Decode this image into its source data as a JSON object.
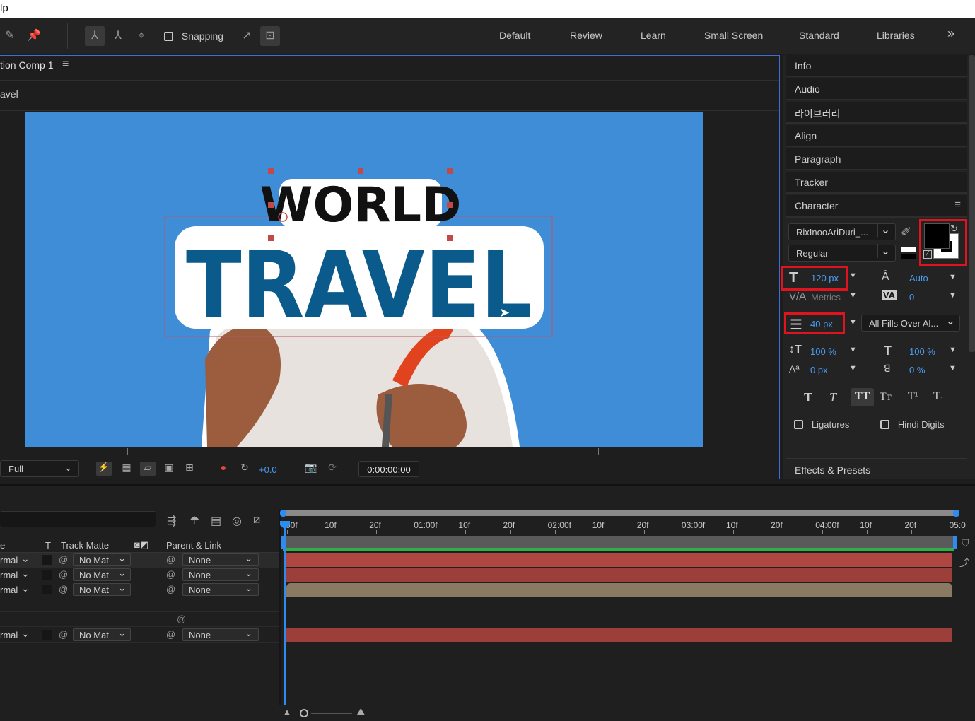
{
  "app": {
    "title_fragment": "lp"
  },
  "toolbar": {
    "snapping_label": "Snapping",
    "workspaces": [
      "Default",
      "Review",
      "Learn",
      "Small Screen",
      "Standard",
      "Libraries"
    ],
    "more_glyph": "»"
  },
  "comp": {
    "tab_title": "tion Comp 1",
    "breadcrumb": "avel",
    "canvas_text_line1": "WORLD",
    "canvas_text_line2": "TRAVEL",
    "resolution": "Full",
    "exposure": "+0.0",
    "timecode": "0:00:00:00",
    "canvas_bg_color": "#3f8dd6",
    "travel_text_color": "#0a5b8c"
  },
  "right_panel": {
    "items": [
      "Info",
      "Audio",
      "라이브러리",
      "Align",
      "Paragraph",
      "Tracker"
    ],
    "character_title": "Character",
    "font_family": "RixInooAriDuri_...",
    "font_style": "Regular",
    "font_size": "120 px",
    "leading": "Auto",
    "kerning": "Metrics",
    "tracking": "0",
    "stroke_width": "40 px",
    "stroke_mode": "All Fills Over Al...",
    "vertical_scale": "100 %",
    "horizontal_scale": "100 %",
    "baseline_shift": "0 px",
    "tsume": "0 %",
    "ligatures_label": "Ligatures",
    "hindi_digits_label": "Hindi Digits",
    "effects_presets": "Effects & Presets",
    "fill_color": "#000000",
    "stroke_color": "#ffffff"
  },
  "timeline": {
    "columns": {
      "name": "e",
      "t": "T",
      "track_matte": "Track Matte",
      "parent_link": "Parent & Link"
    },
    "ruler_labels": [
      "00f",
      "10f",
      "20f",
      "01:00f",
      "10f",
      "20f",
      "02:00f",
      "10f",
      "20f",
      "03:00f",
      "10f",
      "20f",
      "04:00f",
      "10f",
      "20f",
      "05:0"
    ],
    "rows": [
      {
        "mode": "rmal",
        "matte": "No Mat",
        "parent": "None"
      },
      {
        "mode": "rmal",
        "matte": "No Mat",
        "parent": "None"
      },
      {
        "mode": "rmal",
        "matte": "No Mat",
        "parent": "None"
      },
      {
        "mode": "rmal",
        "matte": "No Mat",
        "parent": "None"
      }
    ],
    "bar_colors": {
      "red": "#b04641",
      "tan": "#8a7a62"
    }
  }
}
